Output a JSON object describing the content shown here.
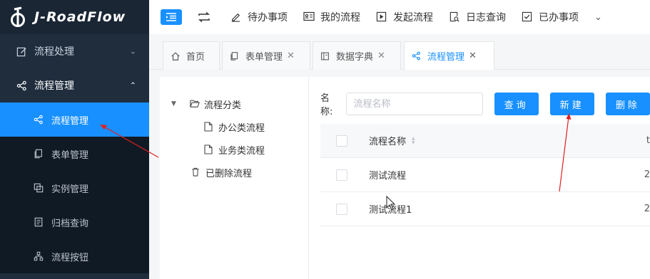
{
  "app": {
    "title": "J-RoadFlow"
  },
  "sidebar": {
    "items": [
      {
        "label": "流程处理",
        "icon": "edit-icon",
        "arrow": "⌄"
      },
      {
        "label": "流程管理",
        "icon": "share-icon",
        "arrow": "⌃"
      }
    ],
    "subitems": [
      {
        "label": "流程管理",
        "icon": "share-icon"
      },
      {
        "label": "表单管理",
        "icon": "copy-icon"
      },
      {
        "label": "实例管理",
        "icon": "layers-icon"
      },
      {
        "label": "归档查询",
        "icon": "archive-icon"
      },
      {
        "label": "流程按钮",
        "icon": "hierarchy-icon"
      }
    ]
  },
  "topbar": {
    "items": [
      {
        "label": "待办事项",
        "icon": "pen-icon"
      },
      {
        "label": "我的流程",
        "icon": "id-card-icon"
      },
      {
        "label": "发起流程",
        "icon": "play-icon"
      },
      {
        "label": "日志查询",
        "icon": "doc-search-icon"
      },
      {
        "label": "已办事项",
        "icon": "checkbox-icon"
      }
    ],
    "more": "⌄"
  },
  "tabs": [
    {
      "label": "首页",
      "icon": "home-icon",
      "closable": false
    },
    {
      "label": "表单管理",
      "icon": "copy-icon",
      "closable": true
    },
    {
      "label": "数据字典",
      "icon": "dict-icon",
      "closable": true
    },
    {
      "label": "流程管理",
      "icon": "share-icon",
      "closable": true
    }
  ],
  "tree": {
    "root": "流程分类",
    "children": [
      "办公类流程",
      "业务类流程"
    ],
    "deleted": "已删除流程"
  },
  "search": {
    "label": "名称:",
    "placeholder": "流程名称",
    "query_label": "查询",
    "new_label": "新建",
    "delete_label": "删除"
  },
  "table": {
    "header": "流程名称",
    "header_more": "t",
    "rows": [
      {
        "name": "测试流程",
        "more": "2"
      },
      {
        "name": "测试流程1",
        "more": "2"
      }
    ]
  },
  "colors": {
    "accent": "#1890ff",
    "sidebar": "#1f2d3d",
    "annotation": "#e02020"
  }
}
